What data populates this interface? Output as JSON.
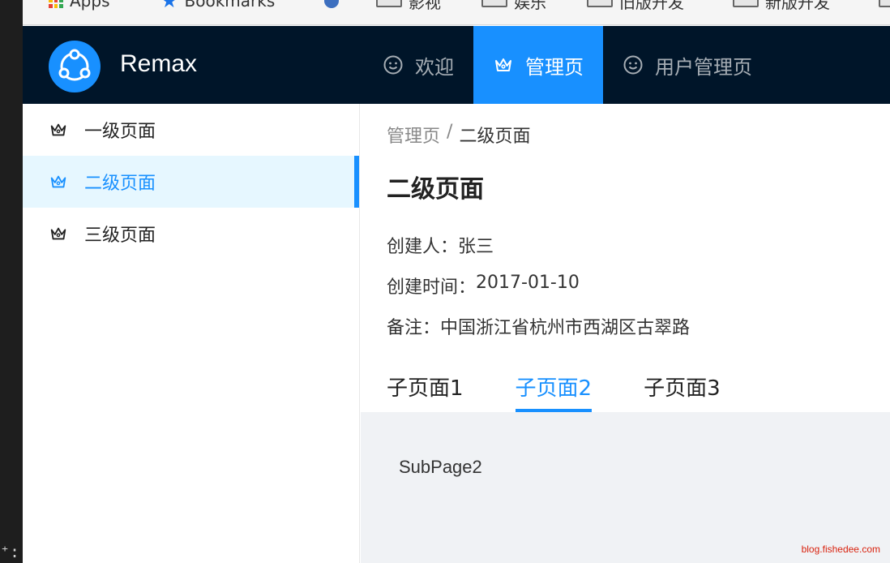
{
  "bookmarks_bar": {
    "items": [
      {
        "label": "Apps"
      },
      {
        "label": "Bookmarks"
      },
      {
        "label": "影视"
      },
      {
        "label": "娱乐"
      },
      {
        "label": "旧版开发"
      },
      {
        "label": "新版开发"
      }
    ]
  },
  "header": {
    "brand": "Remax",
    "logo_icon": "share-nodes-icon",
    "nav": [
      {
        "label": "欢迎",
        "icon": "smile-icon",
        "active": false
      },
      {
        "label": "管理页",
        "icon": "crown-icon",
        "active": true
      },
      {
        "label": "用户管理页",
        "icon": "smile-icon",
        "active": false
      }
    ]
  },
  "sidebar": {
    "items": [
      {
        "label": "一级页面",
        "icon": "crown-icon",
        "active": false
      },
      {
        "label": "二级页面",
        "icon": "crown-icon",
        "active": true
      },
      {
        "label": "三级页面",
        "icon": "crown-icon",
        "active": false
      }
    ]
  },
  "content": {
    "breadcrumb": {
      "parent": "管理页",
      "separator": "/",
      "current": "二级页面"
    },
    "title": "二级页面",
    "descriptions": [
      {
        "label": "创建人：",
        "value": "张三"
      },
      {
        "label": "创建时间：",
        "value": "2017-01-10"
      },
      {
        "label": "备注：",
        "value": "中国浙江省杭州市西湖区古翠路"
      }
    ],
    "tabs": [
      {
        "label": "子页面1",
        "active": false
      },
      {
        "label": "子页面2",
        "active": true
      },
      {
        "label": "子页面3",
        "active": false
      }
    ],
    "tab_content": "SubPage2"
  },
  "watermark": "blog.fishedee.com",
  "colors": {
    "header_bg": "#001529",
    "primary": "#1890ff",
    "active_bg": "#e6f7ff",
    "pane_bg": "#f0f2f5"
  }
}
